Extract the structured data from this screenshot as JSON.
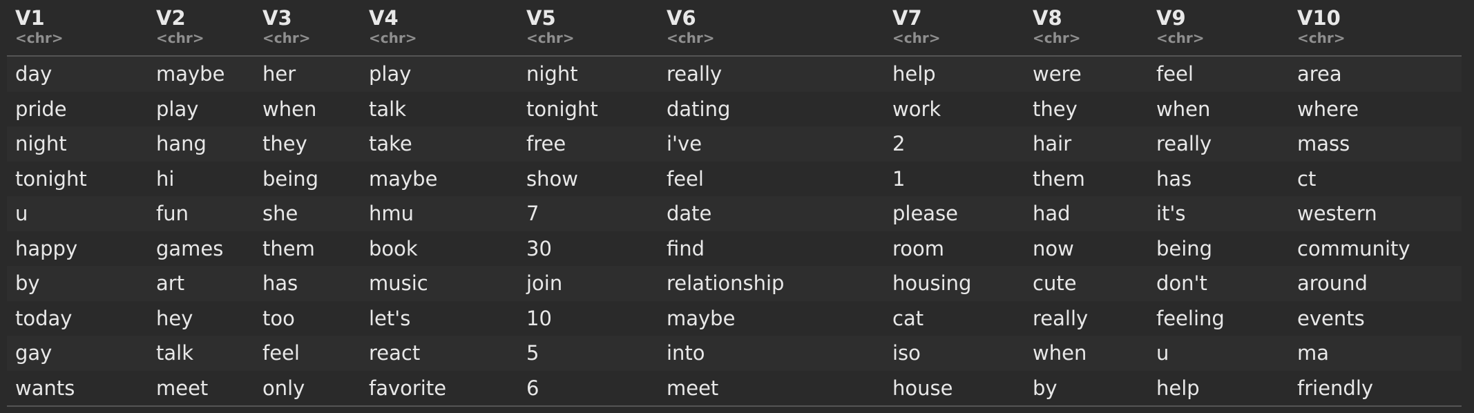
{
  "table": {
    "columns": [
      {
        "name": "V1",
        "type": "<chr>"
      },
      {
        "name": "V2",
        "type": "<chr>"
      },
      {
        "name": "V3",
        "type": "<chr>"
      },
      {
        "name": "V4",
        "type": "<chr>"
      },
      {
        "name": "V5",
        "type": "<chr>"
      },
      {
        "name": "V6",
        "type": "<chr>"
      },
      {
        "name": "V7",
        "type": "<chr>"
      },
      {
        "name": "V8",
        "type": "<chr>"
      },
      {
        "name": "V9",
        "type": "<chr>"
      },
      {
        "name": "V10",
        "type": "<chr>"
      }
    ],
    "rows": [
      [
        "day",
        "maybe",
        "her",
        "play",
        "night",
        "really",
        "help",
        "were",
        "feel",
        "area"
      ],
      [
        "pride",
        "play",
        "when",
        "talk",
        "tonight",
        "dating",
        "work",
        "they",
        "when",
        "where"
      ],
      [
        "night",
        "hang",
        "they",
        "take",
        "free",
        "i've",
        "2",
        "hair",
        "really",
        "mass"
      ],
      [
        "tonight",
        "hi",
        "being",
        "maybe",
        "show",
        "feel",
        "1",
        "them",
        "has",
        "ct"
      ],
      [
        "u",
        "fun",
        "she",
        "hmu",
        "7",
        "date",
        "please",
        "had",
        "it's",
        "western"
      ],
      [
        "happy",
        "games",
        "them",
        "book",
        "30",
        "find",
        "room",
        "now",
        "being",
        "community"
      ],
      [
        "by",
        "art",
        "has",
        "music",
        "join",
        "relationship",
        "housing",
        "cute",
        "don't",
        "around"
      ],
      [
        "today",
        "hey",
        "too",
        "let's",
        "10",
        "maybe",
        "cat",
        "really",
        "feeling",
        "events"
      ],
      [
        "gay",
        "talk",
        "feel",
        "react",
        "5",
        "into",
        "iso",
        "when",
        "u",
        "ma"
      ],
      [
        "wants",
        "meet",
        "only",
        "favorite",
        "6",
        "meet",
        "house",
        "by",
        "help",
        "friendly"
      ]
    ]
  }
}
